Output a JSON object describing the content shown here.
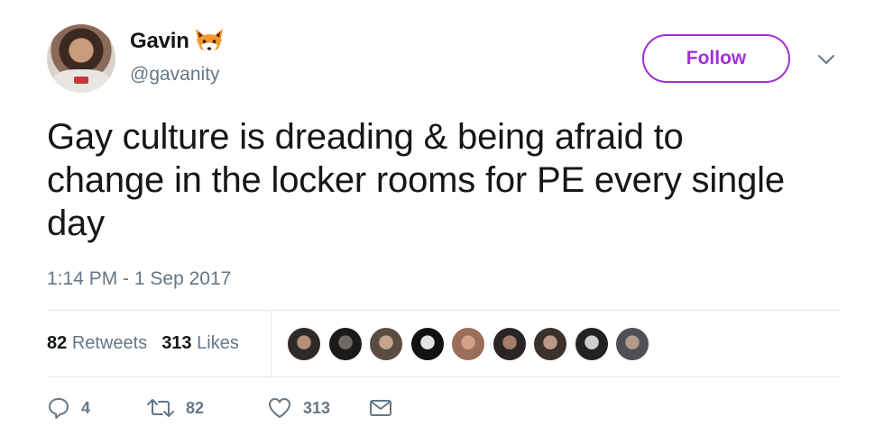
{
  "author": {
    "display_name": "Gavin",
    "handle": "@gavanity",
    "emoji_icon": "fox-face-icon"
  },
  "follow_label": "Follow",
  "tweet": {
    "text": "Gay culture is dreading & being afraid to change in the locker rooms for PE every single day",
    "timestamp": "1:14 PM - 1 Sep 2017"
  },
  "stats": {
    "retweets_count": "82",
    "retweets_label": "Retweets",
    "likes_count": "313",
    "likes_label": "Likes"
  },
  "liker_avatars": [
    {
      "colors": [
        "#2d2a28",
        "#b58f78"
      ]
    },
    {
      "colors": [
        "#1b1a1a",
        "#6f6a66"
      ]
    },
    {
      "colors": [
        "#5a4b43",
        "#c6a48d"
      ]
    },
    {
      "colors": [
        "#111111",
        "#e2e2e2"
      ]
    },
    {
      "colors": [
        "#9a6e5a",
        "#d3a088"
      ]
    },
    {
      "colors": [
        "#2a2523",
        "#a27d68"
      ]
    },
    {
      "colors": [
        "#3b302a",
        "#b99a86"
      ]
    },
    {
      "colors": [
        "#222222",
        "#cfcfcf"
      ]
    },
    {
      "colors": [
        "#4f4f57",
        "#b59a8e"
      ]
    }
  ],
  "actions": {
    "reply_count": "4",
    "retweet_count": "82",
    "like_count": "313"
  },
  "colors": {
    "accent": "#a12fd6",
    "secondary_text": "#657786",
    "divider": "#e1e8ed"
  }
}
